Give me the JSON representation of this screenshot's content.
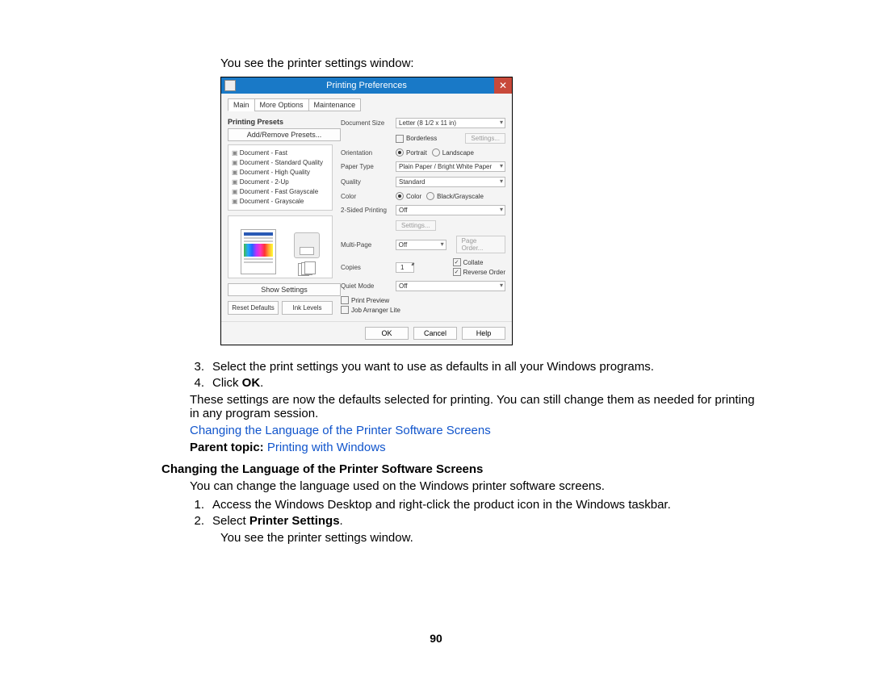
{
  "doc": {
    "intro": "You see the printer settings window:",
    "step3_num": "3.",
    "step3": "Select the print settings you want to use as defaults in all your Windows programs.",
    "step4_num": "4.",
    "step4a": "Click ",
    "step4b": "OK",
    "step4c": ".",
    "note": "These settings are now the defaults selected for printing. You can still change them as needed for printing in any program session.",
    "link1": "Changing the Language of the Printer Software Screens",
    "parent_label": "Parent topic: ",
    "parent_link": "Printing with Windows",
    "h2": "Changing the Language of the Printer Software Screens",
    "p2": "You can change the language used on the Windows printer software screens.",
    "s1_num": "1.",
    "s1": "Access the Windows Desktop and right-click the product icon in the Windows taskbar.",
    "s2_num": "2.",
    "s2a": "Select ",
    "s2b": "Printer Settings",
    "s2c": ".",
    "p3": "You see the printer settings window.",
    "page_number": "90"
  },
  "dlg": {
    "title": "Printing Preferences",
    "close": "✕",
    "tabs": [
      "Main",
      "More Options",
      "Maintenance"
    ],
    "presets_h": "Printing Presets",
    "add_remove": "Add/Remove Presets...",
    "presets": [
      "Document - Fast",
      "Document - Standard Quality",
      "Document - High Quality",
      "Document - 2-Up",
      "Document - Fast Grayscale",
      "Document - Grayscale"
    ],
    "show_settings": "Show Settings",
    "reset_defaults": "Reset Defaults",
    "ink_levels": "Ink Levels",
    "labels": {
      "doc_size": "Document Size",
      "orientation": "Orientation",
      "paper_type": "Paper Type",
      "quality": "Quality",
      "color": "Color",
      "two_sided": "2-Sided Printing",
      "multi_page": "Multi-Page",
      "copies": "Copies",
      "quiet": "Quiet Mode"
    },
    "values": {
      "doc_size": "Letter (8 1/2 x 11 in)",
      "borderless": "Borderless",
      "settings_btn": "Settings...",
      "portrait": "Portrait",
      "landscape": "Landscape",
      "paper_type": "Plain Paper / Bright White Paper",
      "quality": "Standard",
      "color": "Color",
      "grayscale": "Black/Grayscale",
      "two_sided": "Off",
      "settings2": "Settings...",
      "multi_page": "Off",
      "page_order": "Page Order...",
      "copies": "1",
      "collate": "Collate",
      "reverse": "Reverse Order",
      "quiet": "Off",
      "print_preview": "Print Preview",
      "job_arranger": "Job Arranger Lite"
    },
    "footer": {
      "ok": "OK",
      "cancel": "Cancel",
      "help": "Help"
    }
  }
}
